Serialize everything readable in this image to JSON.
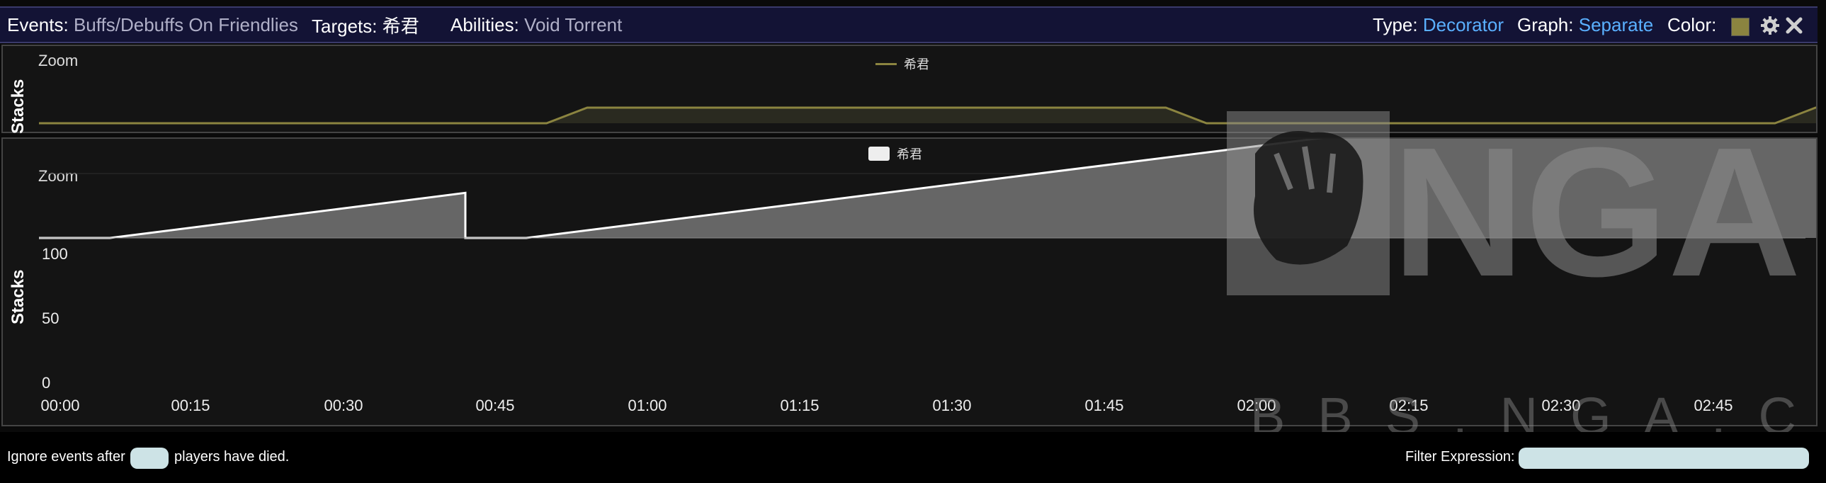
{
  "header": {
    "events_label": "Events:",
    "events_value": "Buffs/Debuffs On Friendlies",
    "targets_label": "Targets:",
    "targets_value": "希君",
    "abilities_label": "Abilities:",
    "abilities_value": "Void Torrent",
    "type_label": "Type:",
    "type_value": "Decorator",
    "graph_label": "Graph:",
    "graph_value": "Separate",
    "color_label": "Color:",
    "swatch_color": "#8b8440"
  },
  "top_panel": {
    "y_label": "Stacks",
    "zoom_label": "Zoom",
    "legend_label": "希君",
    "line_color": "#8b8440"
  },
  "main_panel": {
    "y_label": "Stacks",
    "zoom_label": "Zoom",
    "legend_label": "希君",
    "y_ticks": [
      "100",
      "50",
      "0"
    ],
    "x_ticks": [
      "00:00",
      "00:15",
      "00:30",
      "00:45",
      "01:00",
      "01:15",
      "01:30",
      "01:45",
      "02:00",
      "02:15",
      "02:30",
      "02:45"
    ]
  },
  "chart_data": [
    {
      "type": "line",
      "title": "",
      "series": [
        {
          "name": "希君",
          "x": [
            "00:00",
            "00:50",
            "00:54",
            "01:51",
            "01:55",
            "02:51",
            "02:55",
            "02:56"
          ],
          "y": [
            0,
            0,
            1,
            1,
            0,
            0,
            1,
            1
          ]
        }
      ],
      "grid": false,
      "legend": "top-center"
    },
    {
      "type": "area",
      "title": "",
      "ylabel": "Stacks",
      "ylim": [
        0,
        100
      ],
      "series": [
        {
          "name": "希君",
          "x": [
            "00:00",
            "00:07",
            "00:42",
            "00:42",
            "00:48",
            "02:30",
            "02:58"
          ],
          "y": [
            0,
            0,
            35,
            0,
            0,
            101,
            101
          ]
        }
      ],
      "grid": true,
      "legend": "top-center"
    }
  ],
  "watermark": {
    "main": "NGA",
    "sub": "BBS.NGA.CN"
  },
  "footer": {
    "ignore_prefix": "Ignore events after",
    "ignore_suffix": "players have died.",
    "ignore_value": "",
    "filter_label": "Filter Expression:",
    "filter_value": ""
  }
}
